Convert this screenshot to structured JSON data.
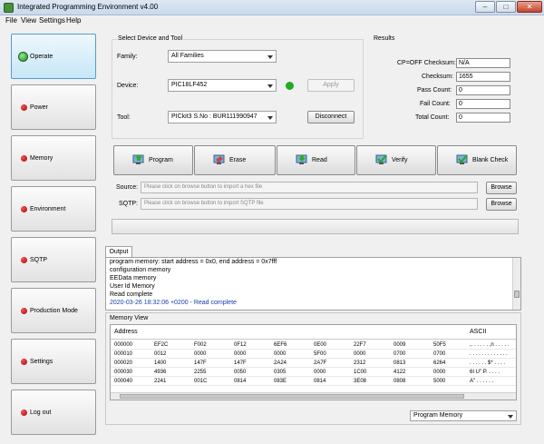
{
  "window": {
    "title": "Integrated Programming Environment v4.00"
  },
  "menu": [
    "File",
    "View",
    "Settings",
    "Help"
  ],
  "nav": [
    {
      "label": "Operate",
      "active": true
    },
    {
      "label": "Power"
    },
    {
      "label": "Memory"
    },
    {
      "label": "Environment"
    },
    {
      "label": "SQTP"
    },
    {
      "label": "Production Mode"
    },
    {
      "label": "Settings"
    },
    {
      "label": "Log out"
    }
  ],
  "select_group": {
    "title": "Select Device and Tool",
    "family_label": "Family:",
    "family_value": "All Families",
    "device_label": "Device:",
    "device_value": "PIC18LF452",
    "apply_label": "Apply",
    "tool_label": "Tool:",
    "tool_value": "PICkit3 S.No : BUR111990947",
    "disconnect_label": "Disconnect",
    "status_color": "#22aa22"
  },
  "results": {
    "title": "Results",
    "rows": [
      {
        "label": "CP=OFF Checksum:",
        "value": "N/A"
      },
      {
        "label": "Checksum:",
        "value": "1655"
      },
      {
        "label": "Pass Count:",
        "value": "0"
      },
      {
        "label": "Fail Count:",
        "value": "0"
      },
      {
        "label": "Total Count:",
        "value": "0"
      }
    ]
  },
  "actions": [
    "Program",
    "Erase",
    "Read",
    "Verify",
    "Blank Check"
  ],
  "source": {
    "label": "Source:",
    "placeholder": "Please click on browse button to import a hex file",
    "browse": "Browse"
  },
  "sqtp": {
    "label": "SQTP:",
    "placeholder": "Please click on browse button to import SQTP file",
    "browse": "Browse"
  },
  "output": {
    "tab": "Output",
    "lines": [
      "program memory: start address = 0x0, end address = 0x7fff",
      "configuration memory",
      "EEData memory",
      "User Id Memory",
      "Read complete",
      "2020-03-26 18:32:06 +0200 - Read complete"
    ]
  },
  "memory_view": {
    "title": "Memory View",
    "headers": [
      "Address",
      "",
      "",
      "",
      "",
      "",
      "",
      "",
      "",
      "ASCII"
    ],
    "rows": [
      [
        "000000",
        "EF2C",
        "F002",
        "0F12",
        "6EF6",
        "0E00",
        "22F7",
        "0009",
        "50F5",
        ",. . . . . . ,n . . . . ."
      ],
      [
        "000010",
        "0012",
        "0000",
        "0000",
        "0000",
        "5F00",
        "0000",
        "0700",
        "0700",
        ". . . . . . . . . . . . ."
      ],
      [
        "000020",
        "1400",
        "147F",
        "147F",
        "2A24",
        "2A7F",
        "2312",
        "0813",
        "6264",
        ". . . . . . $* . . . ."
      ],
      [
        "000030",
        "4936",
        "2255",
        "0050",
        "0305",
        "0000",
        "1C00",
        "4122",
        "0000",
        "6I U\" P. . . . ."
      ],
      [
        "000040",
        "2241",
        "001C",
        "0814",
        "083E",
        "0814",
        "3E08",
        "0808",
        "5000",
        "A\" . . . . . ."
      ]
    ],
    "select_value": "Program Memory"
  }
}
